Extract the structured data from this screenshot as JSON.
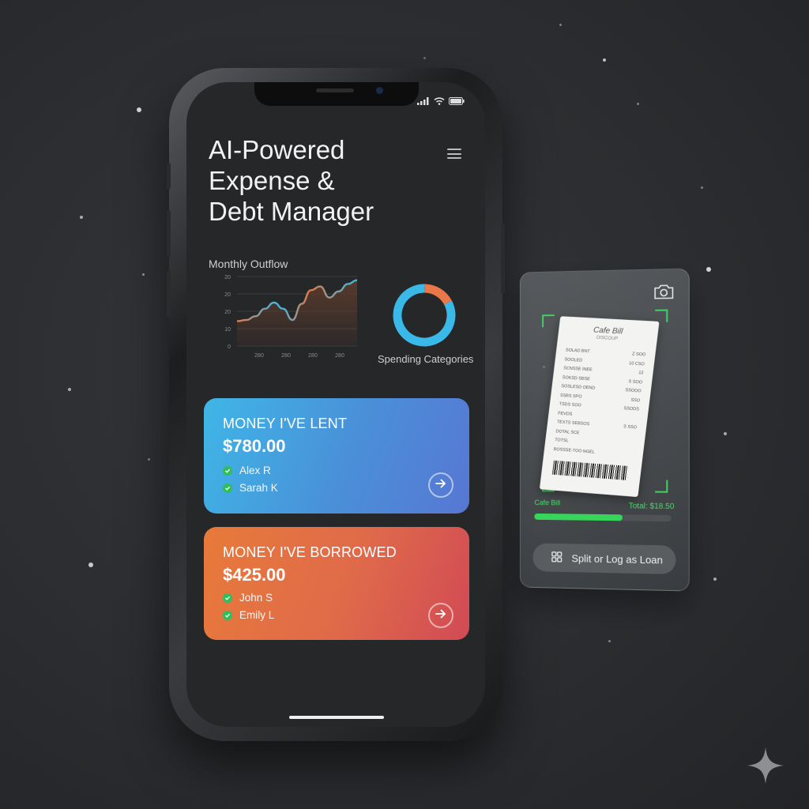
{
  "app": {
    "title": "AI-Powered\nExpense &\nDebt Manager"
  },
  "chart_data": [
    {
      "type": "area",
      "title": "Monthly Outflow",
      "y_ticks": [
        "20",
        "20",
        "20",
        "10",
        "0"
      ],
      "x_ticks": [
        "280",
        "280",
        "280",
        "280"
      ],
      "series": [
        {
          "values": [
            10,
            10.5,
            12,
            15,
            17.5,
            15,
            10.5,
            17,
            22.5,
            24,
            19.5,
            22,
            25,
            26.5
          ]
        }
      ],
      "ylim": [
        0,
        28
      ],
      "grid": true,
      "colors": {
        "stroke_start": "#e07a4a",
        "stroke_end": "#3bb8e6",
        "fill": "#5a3a2c"
      }
    },
    {
      "type": "pie",
      "title": "Spending Categories",
      "donut": true,
      "slices": [
        {
          "value": 83,
          "color": "#3ab8e8"
        },
        {
          "value": 17,
          "color": "#e8784a"
        }
      ]
    }
  ],
  "lent": {
    "label": "MONEY I'VE LENT",
    "amount": "$780.00",
    "people": [
      "Alex R",
      "Sarah K"
    ]
  },
  "borrowed": {
    "label": "MONEY I'VE BORROWED",
    "amount": "$425.00",
    "people": [
      "John S",
      "Emily L"
    ]
  },
  "scanner": {
    "receipt_title": "Cafe Bill",
    "receipt_subtitle": "DISCOUP",
    "receipt_rows": [
      [
        "SOLAD BNT",
        "Z  SOO"
      ],
      [
        "SOOLED",
        "10  CSO"
      ],
      [
        "SCNSSE INEE",
        "12"
      ],
      [
        "SOKSD SBSE",
        "S  SOO"
      ],
      [
        "SOSLESD OEND",
        "SSOOO"
      ],
      [
        "SSBS SPO",
        "SSO"
      ],
      [
        "TSDS SOO",
        "SSODS"
      ],
      [
        "FEVDS",
        ""
      ],
      [
        "TEXTS SEBSOS",
        "S  SSO"
      ],
      [
        "DOTAL SCE",
        ""
      ],
      [
        "TOTSL",
        ""
      ],
      [
        "BOSSSE-TOO NGEL",
        ""
      ]
    ],
    "bill_label": "Cafe Bill",
    "total_label": "Total: $18.50",
    "progress": 0.65,
    "action_label": "Split or Log as Loan"
  },
  "icons": {
    "menu": "hamburger-menu-icon",
    "camera": "camera-icon",
    "arrow": "arrow-right-circle-icon",
    "check": "check-circle-icon",
    "split": "grid-icon",
    "sparkle": "sparkle-icon"
  }
}
